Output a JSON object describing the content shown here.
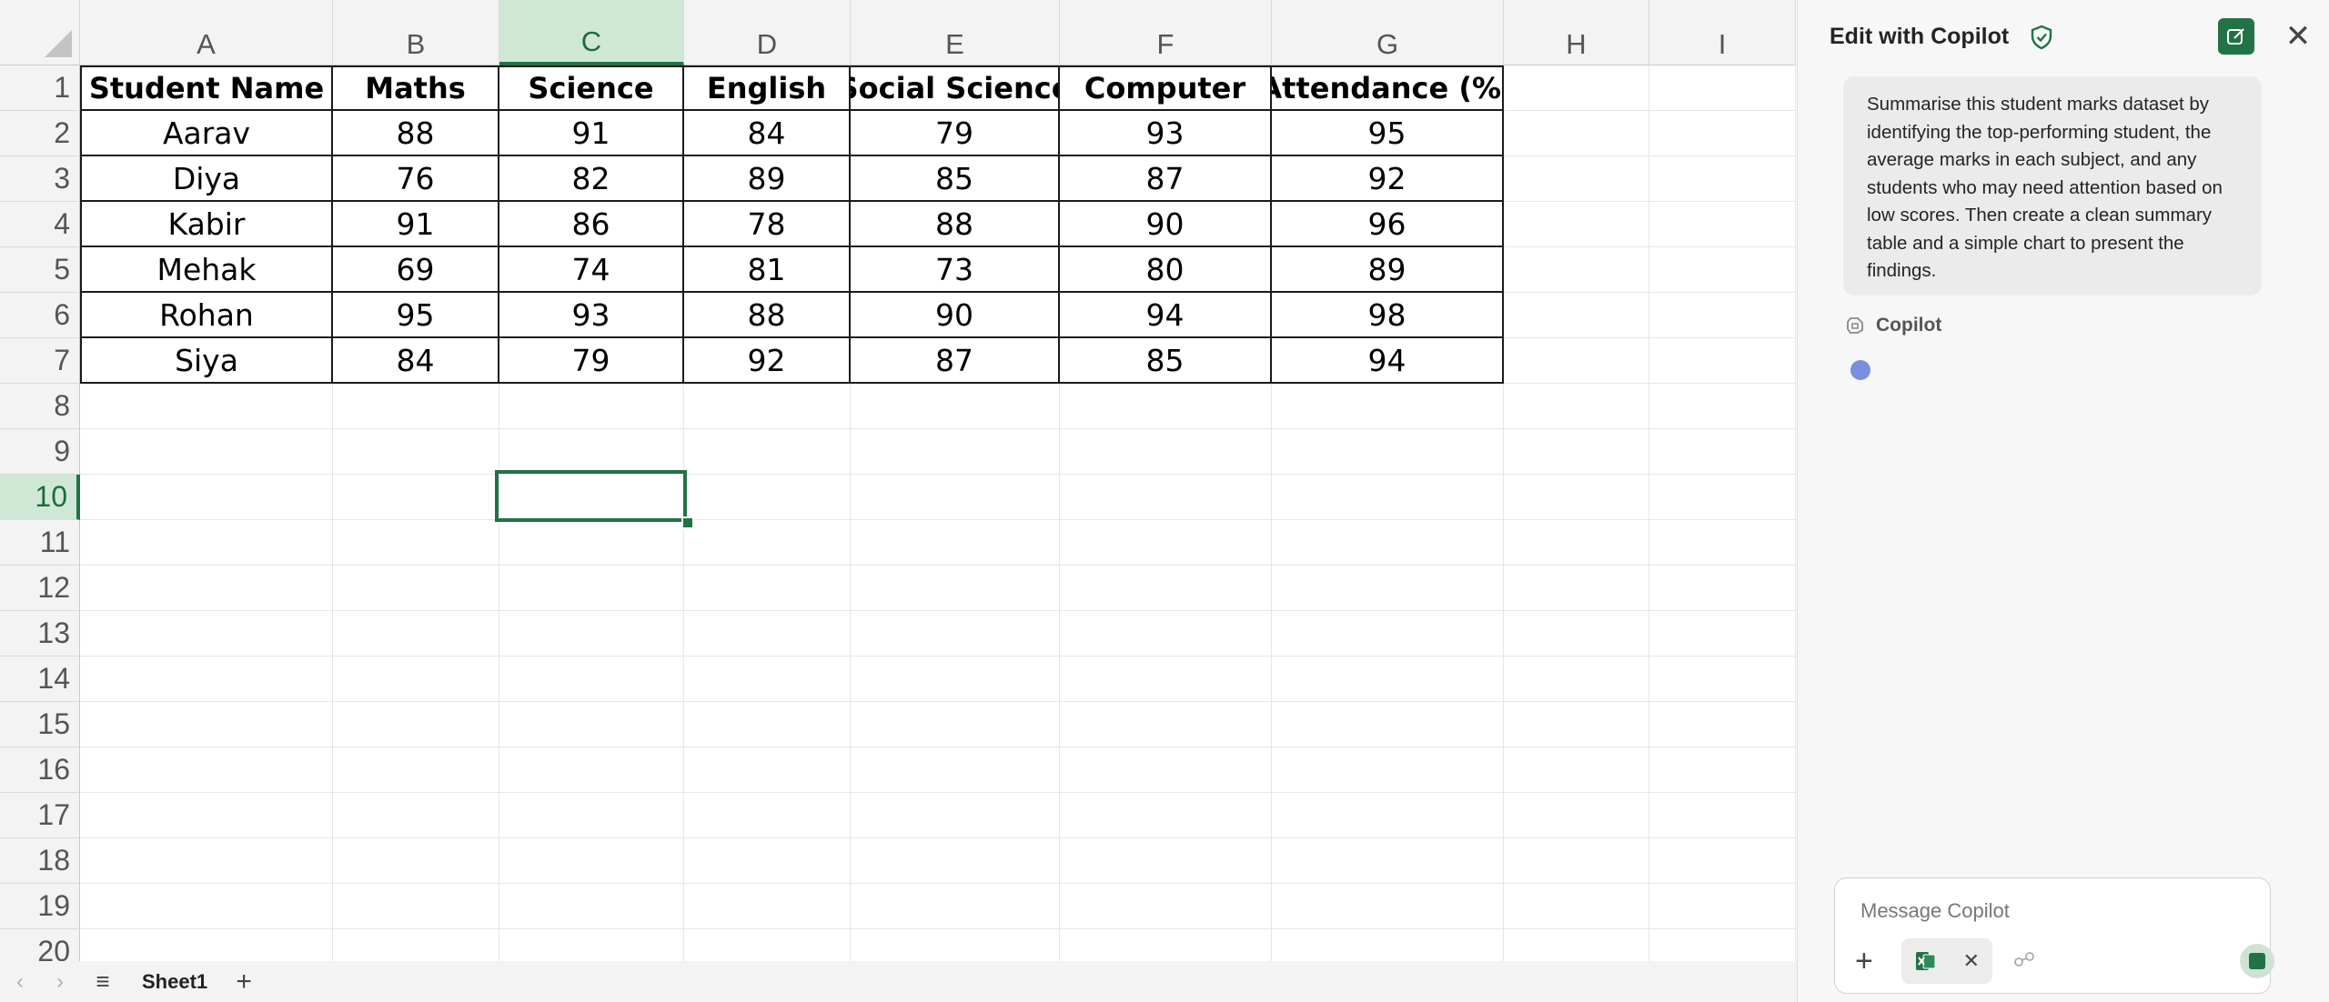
{
  "columns": [
    "A",
    "B",
    "C",
    "D",
    "E",
    "F",
    "G",
    "H",
    "I"
  ],
  "rows": [
    "1",
    "2",
    "3",
    "4",
    "5",
    "6",
    "7",
    "8",
    "9",
    "10",
    "11",
    "12",
    "13",
    "14",
    "15",
    "16",
    "17",
    "18",
    "19",
    "20"
  ],
  "selected_column": "C",
  "selected_row": "10",
  "table": {
    "headers": [
      "Student Name",
      "Maths",
      "Science",
      "English",
      "Social Science",
      "Computer",
      "Attendance (%)"
    ],
    "records": [
      [
        "Aarav",
        "88",
        "91",
        "84",
        "79",
        "93",
        "95"
      ],
      [
        "Diya",
        "76",
        "82",
        "89",
        "85",
        "87",
        "92"
      ],
      [
        "Kabir",
        "91",
        "86",
        "78",
        "88",
        "90",
        "96"
      ],
      [
        "Mehak",
        "69",
        "74",
        "81",
        "73",
        "80",
        "89"
      ],
      [
        "Rohan",
        "95",
        "93",
        "88",
        "90",
        "94",
        "98"
      ],
      [
        "Siya",
        "84",
        "79",
        "92",
        "87",
        "85",
        "94"
      ]
    ]
  },
  "sheet_bar": {
    "prev_arrow": "‹",
    "next_arrow": "›",
    "menu_icon": "≡",
    "active_sheet": "Sheet1",
    "add_label": "+"
  },
  "copilot": {
    "title": "Edit with Copilot",
    "close_label": "✕",
    "prompt": "Summarise this student marks dataset by identifying the top-performing student, the average marks in each subject, and any students who may need attention based on low scores. Then create a clean summary table and a simple chart to present the findings.",
    "assistant_label": "Copilot",
    "input_placeholder": "Message Copilot",
    "plus_label": "+",
    "chip_remove": "✕"
  },
  "colors": {
    "accent": "#217346",
    "selected_header_bg": "#cfe8d6",
    "loading_dot": "#7a8ee0"
  }
}
